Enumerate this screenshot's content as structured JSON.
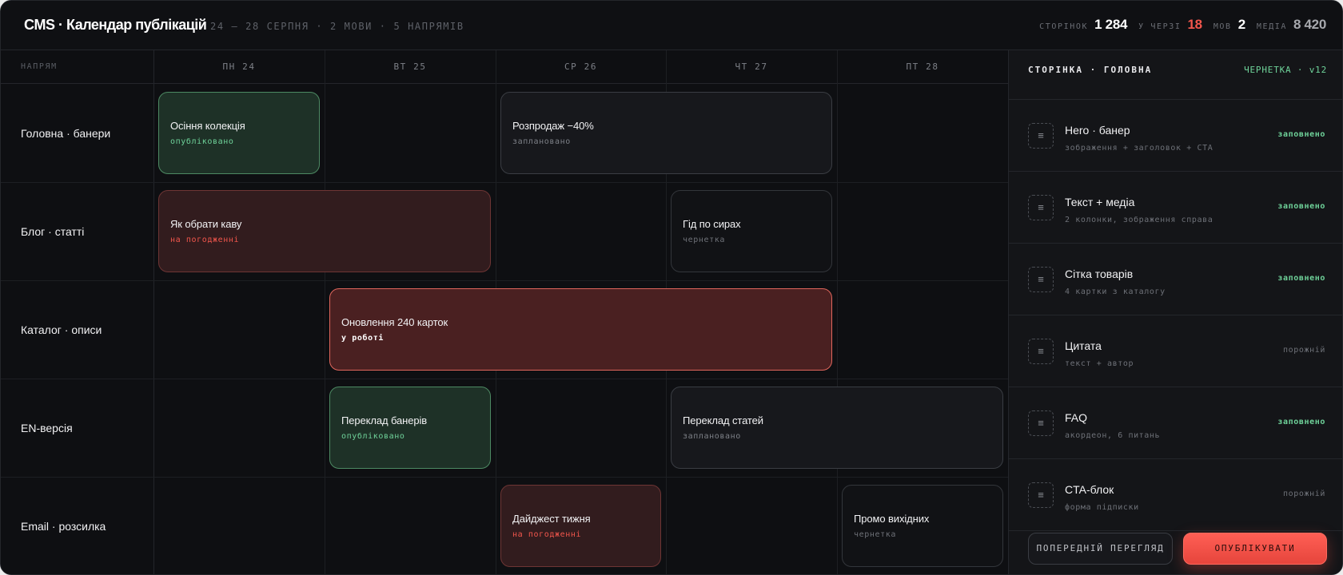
{
  "header": {
    "title": "CMS · Календар публікацій",
    "subtitle": "24 — 28 СЕРПНЯ · 2 МОВИ · 5 НАПРЯМІВ",
    "stats": [
      {
        "label": "СТОРІНОК",
        "value": "1 284"
      },
      {
        "label": "У ЧЕРЗІ",
        "value": "18"
      },
      {
        "label": "МОВ",
        "value": "2"
      },
      {
        "label": "МЕДІА",
        "value": "8 420"
      }
    ]
  },
  "calendar": {
    "corner_label": "НАПРЯМ",
    "days": [
      "ПН 24",
      "ВТ 25",
      "СР 26",
      "ЧТ 27",
      "ПТ 28"
    ],
    "rows": [
      "Головна · банери",
      "Блог · статті",
      "Каталог · описи",
      "EN-версія",
      "Email · розсилка"
    ],
    "events": [
      {
        "title": "Осіння колекція",
        "status": "опубліковано",
        "state": "published",
        "row": 0,
        "day": 0,
        "span": 1
      },
      {
        "title": "Розпродаж −40%",
        "status": "заплановано",
        "state": "scheduled",
        "row": 0,
        "day": 2,
        "span": 2
      },
      {
        "title": "Як обрати каву",
        "status": "на погодженні",
        "state": "review",
        "row": 1,
        "day": 0,
        "span": 2
      },
      {
        "title": "Гід по сирах",
        "status": "чернетка",
        "state": "draft",
        "row": 1,
        "day": 3,
        "span": 1
      },
      {
        "title": "Оновлення 240 карток",
        "status": "у роботі",
        "state": "progress",
        "row": 2,
        "day": 1,
        "span": 3
      },
      {
        "title": "Переклад банерів",
        "status": "опубліковано",
        "state": "published",
        "row": 3,
        "day": 1,
        "span": 1
      },
      {
        "title": "Переклад статей",
        "status": "заплановано",
        "state": "scheduled",
        "row": 3,
        "day": 3,
        "span": 2
      },
      {
        "title": "Дайджест тижня",
        "status": "на погодженні",
        "state": "review",
        "row": 4,
        "day": 2,
        "span": 1
      },
      {
        "title": "Промо вихідних",
        "status": "чернетка",
        "state": "draft",
        "row": 4,
        "day": 4,
        "span": 1
      }
    ]
  },
  "panel": {
    "title": "СТОРІНКА · ГОЛОВНА",
    "version": "ЧЕРНЕТКА · v12",
    "drag_icon": "≡",
    "blocks": [
      {
        "name": "Hero · банер",
        "desc": "зображення + заголовок + CTA",
        "state": "заповнено",
        "filled": true
      },
      {
        "name": "Текст + медіа",
        "desc": "2 колонки, зображення справа",
        "state": "заповнено",
        "filled": true
      },
      {
        "name": "Сітка товарів",
        "desc": "4 картки з каталогу",
        "state": "заповнено",
        "filled": true
      },
      {
        "name": "Цитата",
        "desc": "текст + автор",
        "state": "порожній",
        "filled": false
      },
      {
        "name": "FAQ",
        "desc": "акордеон, 6 питань",
        "state": "заповнено",
        "filled": true
      },
      {
        "name": "CTA-блок",
        "desc": "форма підписки",
        "state": "порожній",
        "filled": false
      }
    ],
    "preview_label": "ПОПЕРЕДНІЙ ПЕРЕГЛЯД",
    "publish_label": "ОПУБЛІКУВАТИ"
  },
  "colors": {
    "accent": "#f2564c",
    "published": "#6fd39a",
    "background": "#0e0f12"
  }
}
